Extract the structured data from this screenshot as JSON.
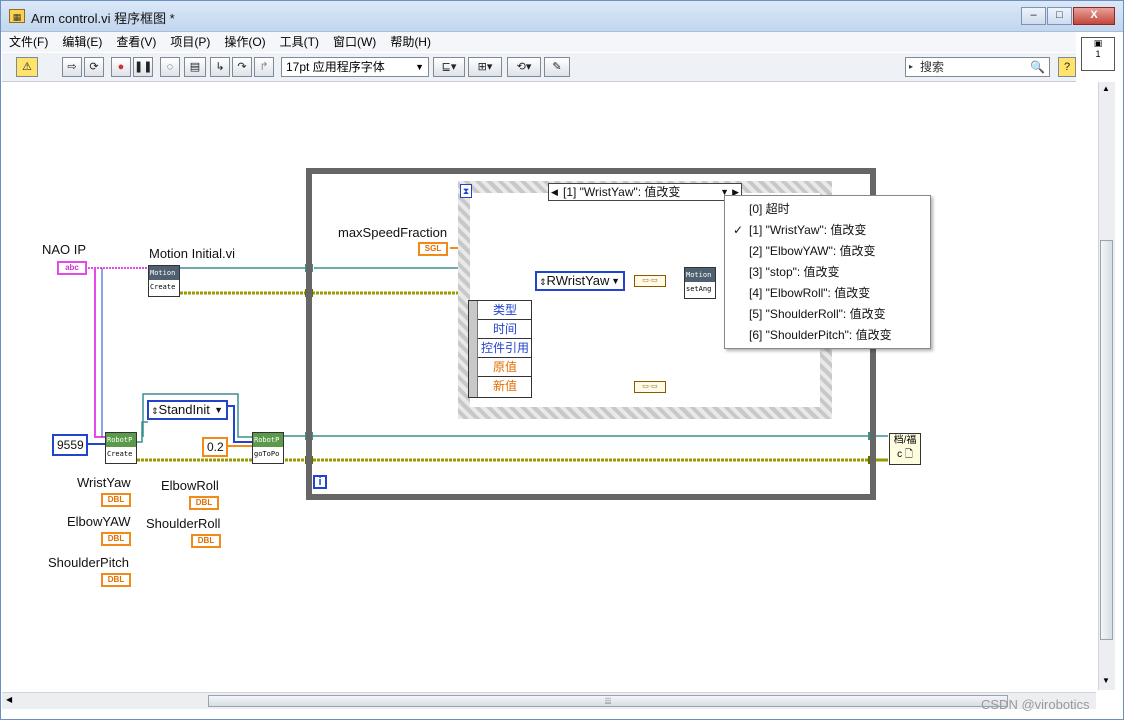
{
  "window": {
    "title": "Arm control.vi 程序框图 *",
    "buttons": {
      "minimize": "–",
      "maximize": "□",
      "close": "X"
    }
  },
  "menu": [
    "文件(F)",
    "编辑(E)",
    "查看(V)",
    "项目(P)",
    "操作(O)",
    "工具(T)",
    "窗口(W)",
    "帮助(H)"
  ],
  "toolbar": {
    "font": "17pt 应用程序字体",
    "search_placeholder": "搜索",
    "buttons": [
      "warning-icon",
      "run-icon",
      "run-continuous-icon",
      "abort-icon",
      "pause-icon",
      "highlight-icon",
      "retain-wire-icon",
      "step-into-icon",
      "step-over-icon",
      "step-out-icon",
      "align-icon",
      "distribute-icon",
      "reorder-icon",
      "clean-up-icon",
      "help-icon"
    ]
  },
  "diagram": {
    "labels": {
      "nao_ip": "NAO IP",
      "motion_initial": "Motion Initial.vi",
      "max_speed": "maxSpeedFraction",
      "wrist_yaw": "WristYaw",
      "elbow_roll": "ElbowRoll",
      "elbow_yaw": "ElbowYAW",
      "shoulder_roll": "ShoulderRoll",
      "shoulder_pitch": "ShoulderPitch"
    },
    "constants": {
      "port": "9559",
      "speed": "0.2",
      "stand_init": "StandInit",
      "rwrist_yaw": "RWristYaw"
    },
    "terminals": {
      "str": "abc",
      "sgl": "SGL",
      "dbl": "DBL"
    },
    "subvis": {
      "motion_create": {
        "top": "Motion",
        "bottom": "Create"
      },
      "robot_create": {
        "top": "RobotP",
        "bottom": "Create"
      },
      "robot_goto": {
        "top": "RobotP",
        "bottom": "goToPo"
      },
      "motion_setang": {
        "top": "Motion",
        "bottom": "setAng"
      }
    },
    "event_selector": "[1] \"WristYaw\": 值改变",
    "event_data": [
      "类型",
      "时间",
      "控件引用",
      "原值",
      "新值"
    ],
    "loop_index": "i",
    "right_node": {
      "top": "档/福",
      "bottom": "c 🗋"
    }
  },
  "dropdown": {
    "items": [
      {
        "label": "[0] 超时",
        "checked": false
      },
      {
        "label": "[1] \"WristYaw\": 值改变",
        "checked": true
      },
      {
        "label": "[2] \"ElbowYAW\": 值改变",
        "checked": false
      },
      {
        "label": "[3] \"stop\": 值改变",
        "checked": false
      },
      {
        "label": "[4] \"ElbowRoll\": 值改变",
        "checked": false
      },
      {
        "label": "[5] \"ShoulderRoll\": 值改变",
        "checked": false
      },
      {
        "label": "[6] \"ShoulderPitch\": 值改变",
        "checked": false
      }
    ],
    "check": "✓"
  },
  "watermark": "CSDN @virobotics",
  "colors": {
    "ref_wire": "#3a8f8f",
    "error_wire": "#9a9a00",
    "string_wire": "#e64ae6",
    "numeric_wire": "#f08a1a",
    "enum_wire": "#2244cc"
  }
}
